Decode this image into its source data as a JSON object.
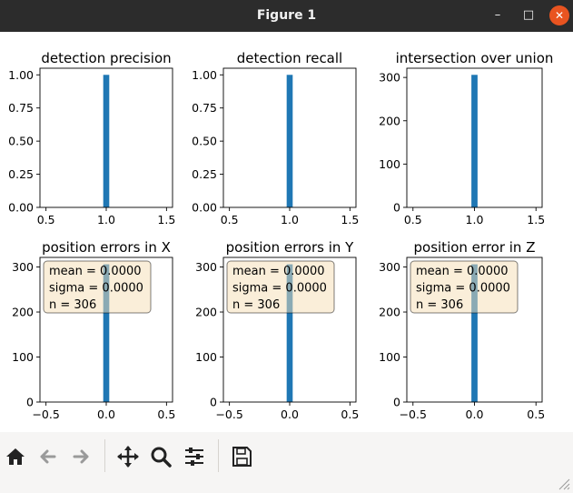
{
  "window": {
    "title": "Figure 1",
    "controls": [
      "minimize-icon",
      "maximize-icon",
      "close-icon"
    ]
  },
  "colors": {
    "bar": "#1f77b4",
    "stats_box_fill": "#f5deb3",
    "stats_box_edge": "#000000",
    "titlebar": "#2c2c2c",
    "close_button": "#e95420",
    "toolbar": "#f6f5f4"
  },
  "toolbar": {
    "icons": [
      "home-icon",
      "back-icon",
      "forward-icon",
      "pan-icon",
      "zoom-icon",
      "configure-subplots-icon",
      "save-icon"
    ]
  },
  "chart_data": [
    {
      "type": "bar",
      "title": "detection precision",
      "xlim": [
        0.45,
        1.55
      ],
      "ylim": [
        0,
        1.05
      ],
      "xticks": [
        0.5,
        1.0,
        1.5
      ],
      "xtick_labels": [
        "0.5",
        "1.0",
        "1.5"
      ],
      "yticks": [
        0,
        0.25,
        0.5,
        0.75,
        1.0
      ],
      "ytick_labels": [
        "0.00",
        "0.25",
        "0.50",
        "0.75",
        "1.00"
      ],
      "bars": [
        {
          "x0": 0.975,
          "x1": 1.025,
          "value": 1.0
        }
      ]
    },
    {
      "type": "bar",
      "title": "detection recall",
      "xlim": [
        0.45,
        1.55
      ],
      "ylim": [
        0,
        1.05
      ],
      "xticks": [
        0.5,
        1.0,
        1.5
      ],
      "xtick_labels": [
        "0.5",
        "1.0",
        "1.5"
      ],
      "yticks": [
        0,
        0.25,
        0.5,
        0.75,
        1.0
      ],
      "ytick_labels": [
        "0.00",
        "0.25",
        "0.50",
        "0.75",
        "1.00"
      ],
      "bars": [
        {
          "x0": 0.975,
          "x1": 1.025,
          "value": 1.0
        }
      ]
    },
    {
      "type": "bar",
      "title": "intersection over union",
      "xlim": [
        0.45,
        1.55
      ],
      "ylim": [
        0,
        321.3
      ],
      "xticks": [
        0.5,
        1.0,
        1.5
      ],
      "xtick_labels": [
        "0.5",
        "1.0",
        "1.5"
      ],
      "yticks": [
        0,
        100,
        200,
        300
      ],
      "ytick_labels": [
        "0",
        "100",
        "200",
        "300"
      ],
      "bars": [
        {
          "x0": 0.975,
          "x1": 1.025,
          "value": 306
        }
      ]
    },
    {
      "type": "bar",
      "title": "position errors in X",
      "xlim": [
        -0.55,
        0.55
      ],
      "ylim": [
        0,
        321.3
      ],
      "xticks": [
        -0.5,
        0.0,
        0.5
      ],
      "xtick_labels": [
        "−0.5",
        "0.0",
        "0.5"
      ],
      "yticks": [
        0,
        100,
        200,
        300
      ],
      "ytick_labels": [
        "0",
        "100",
        "200",
        "300"
      ],
      "bars": [
        {
          "x0": -0.025,
          "x1": 0.025,
          "value": 306
        }
      ],
      "annotation": [
        "mean = 0.0000",
        "sigma = 0.0000",
        "n = 306"
      ]
    },
    {
      "type": "bar",
      "title": "position errors in Y",
      "xlim": [
        -0.55,
        0.55
      ],
      "ylim": [
        0,
        321.3
      ],
      "xticks": [
        -0.5,
        0.0,
        0.5
      ],
      "xtick_labels": [
        "−0.5",
        "0.0",
        "0.5"
      ],
      "yticks": [
        0,
        100,
        200,
        300
      ],
      "ytick_labels": [
        "0",
        "100",
        "200",
        "300"
      ],
      "bars": [
        {
          "x0": -0.025,
          "x1": 0.025,
          "value": 306
        }
      ],
      "annotation": [
        "mean = 0.0000",
        "sigma = 0.0000",
        "n = 306"
      ]
    },
    {
      "type": "bar",
      "title": "position error in Z",
      "xlim": [
        -0.55,
        0.55
      ],
      "ylim": [
        0,
        321.3
      ],
      "xticks": [
        -0.5,
        0.0,
        0.5
      ],
      "xtick_labels": [
        "−0.5",
        "0.0",
        "0.5"
      ],
      "yticks": [
        0,
        100,
        200,
        300
      ],
      "ytick_labels": [
        "0",
        "100",
        "200",
        "300"
      ],
      "bars": [
        {
          "x0": -0.025,
          "x1": 0.025,
          "value": 306
        }
      ],
      "annotation": [
        "mean = 0.0000",
        "sigma = 0.0000",
        "n = 306"
      ]
    }
  ]
}
